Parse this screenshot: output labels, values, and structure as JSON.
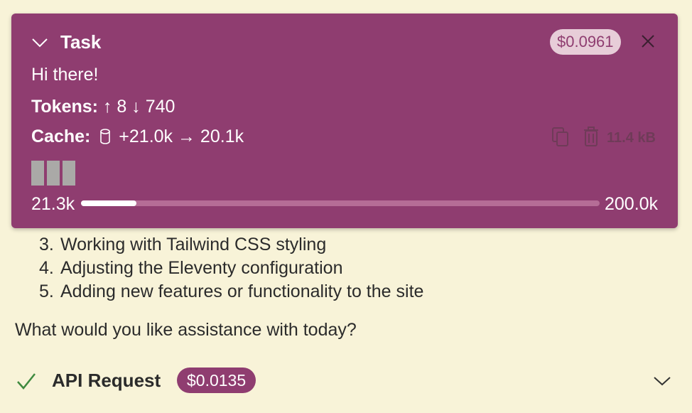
{
  "task": {
    "title": "Task",
    "cost": "$0.0961",
    "message": "Hi there!",
    "tokens_label": "Tokens:",
    "tokens_in": "↑ 8",
    "tokens_out": "↓ 740",
    "cache_label": "Cache:",
    "cache_value": "+21.0k → 20.1k",
    "size": "11.4 kB",
    "context_used": "21.3k",
    "context_max": "200.0k",
    "context_fraction": 0.1065
  },
  "chat": {
    "list_items": [
      {
        "num": "3.",
        "text": "Working with Tailwind CSS styling"
      },
      {
        "num": "4.",
        "text": "Adjusting the Eleventy configuration"
      },
      {
        "num": "5.",
        "text": "Adding new features or functionality to the site"
      }
    ],
    "question": "What would you like assistance with today?",
    "api_label": "API Request",
    "api_cost": "$0.0135"
  },
  "colors": {
    "panel": "#8f3d70",
    "background": "#f8f3d8",
    "check": "#3f8a3f"
  }
}
